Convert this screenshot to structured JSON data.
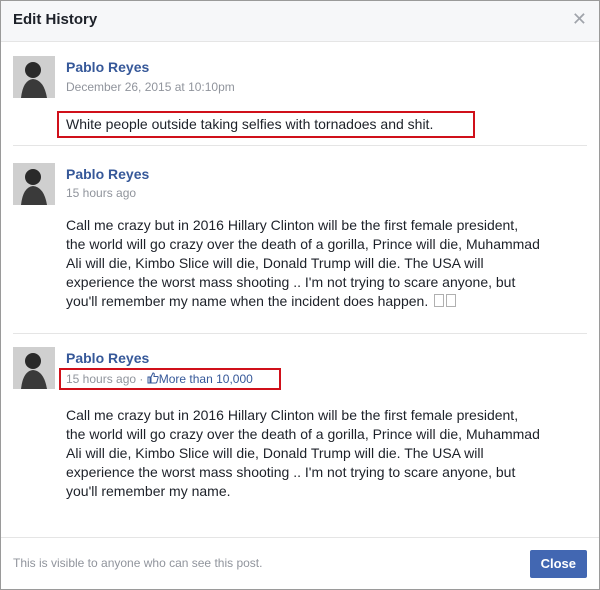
{
  "dialog": {
    "title": "Edit History",
    "close_icon": "close-icon"
  },
  "entries": [
    {
      "author": "Pablo Reyes",
      "timestamp": "December 26, 2015 at 10:10pm",
      "text": "White people outside taking selfies with tornadoes and shit."
    },
    {
      "author": "Pablo Reyes",
      "timestamp": "15 hours ago",
      "text": "Call me crazy but in 2016 Hillary Clinton will be the first female president,\nthe world will go crazy over the death of a gorilla, Prince will die, Muhammad\nAli will die, Kimbo Slice will die, Donald Trump will die. The USA will\nexperience the worst mass shooting .. I'm not trying to scare anyone, but\nyou'll remember my name when the incident does happen."
    },
    {
      "author": "Pablo Reyes",
      "timestamp": "15 hours ago",
      "separator": "·",
      "likes": "More than 10,000",
      "text": "Call me crazy but in 2016 Hillary Clinton will be the first female president,\nthe world will go crazy over the death of a gorilla, Prince will die, Muhammad\nAli will die, Kimbo Slice will die, Donald Trump will die. The USA will\nexperience the worst mass shooting .. I'm not trying to scare anyone, but\nyou'll remember my name."
    }
  ],
  "footer": {
    "note": "This is visible to anyone who can see this post.",
    "close_label": "Close"
  },
  "colors": {
    "link": "#365899",
    "highlight_box": "#d0101a",
    "button": "#4267b2"
  }
}
